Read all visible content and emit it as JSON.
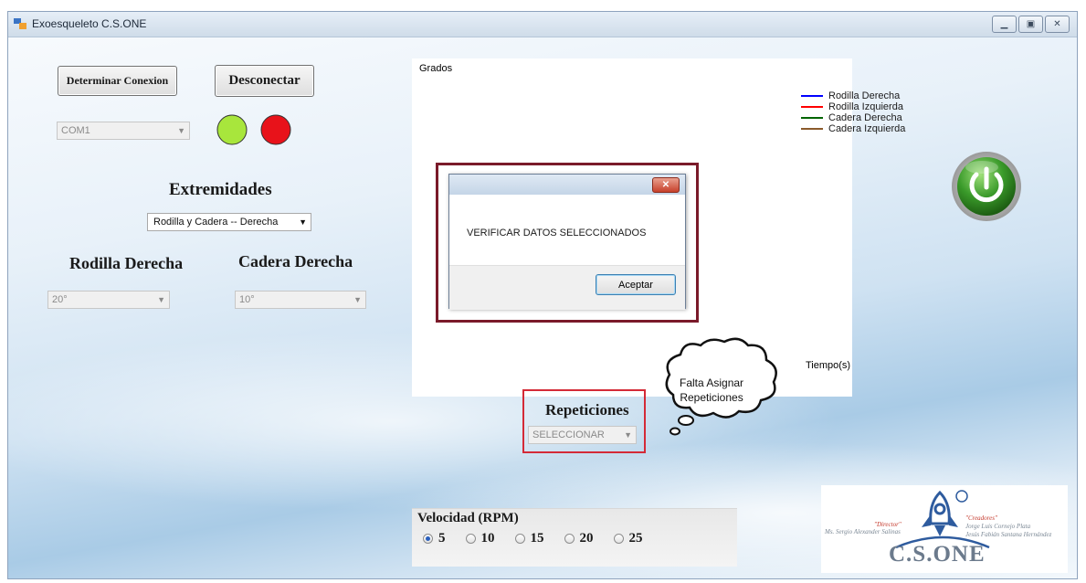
{
  "window": {
    "title": "Exoesqueleto  C.S.ONE"
  },
  "connection": {
    "determinar_label": "Determinar Conexion",
    "desconectar_label": "Desconectar",
    "port": "COM1"
  },
  "extremidades": {
    "label": "Extremidades",
    "selected": "Rodilla y Cadera -- Derecha"
  },
  "rodilla": {
    "label": "Rodilla Derecha",
    "value": "20°"
  },
  "cadera": {
    "label": "Cadera Derecha",
    "value": "10°"
  },
  "chart": {
    "ylabel": "Grados",
    "xlabel": "Tiempo(s)",
    "legend": [
      {
        "name": "Rodilla Derecha",
        "color": "#0000ff"
      },
      {
        "name": "Rodilla Izquierda",
        "color": "#ff0000"
      },
      {
        "name": "Cadera Derecha",
        "color": "#006400"
      },
      {
        "name": "Cadera Izquierda",
        "color": "#8b5a2b"
      }
    ]
  },
  "dialog": {
    "message": "VERIFICAR DATOS SELECCIONADOS",
    "ok_label": "Aceptar"
  },
  "callout": {
    "line1": "Falta Asignar",
    "line2": "Repeticiones"
  },
  "repeticiones": {
    "label": "Repeticiones",
    "selected": "SELECCIONAR"
  },
  "velocidad": {
    "label": "Velocidad (RPM)",
    "options": [
      "5",
      "10",
      "15",
      "20",
      "25"
    ],
    "selected": "5"
  },
  "logo": {
    "director_title": "\"Director\"",
    "director_name": "Ms. Sergio Alexander Salinas",
    "creators_title": "\"Creadores\"",
    "creator1": "Jorge Luis Cornejo Plata",
    "creator2": "Jesús Fabián Santana Hernández",
    "brand": "C.S.ONE"
  },
  "colors": {
    "indicator_on": "#a8e63c",
    "indicator_off": "#e8121a",
    "highlight_box": "#7a1a2a",
    "highlight_red": "#d42a37",
    "power_green": "#3a9a2a"
  }
}
